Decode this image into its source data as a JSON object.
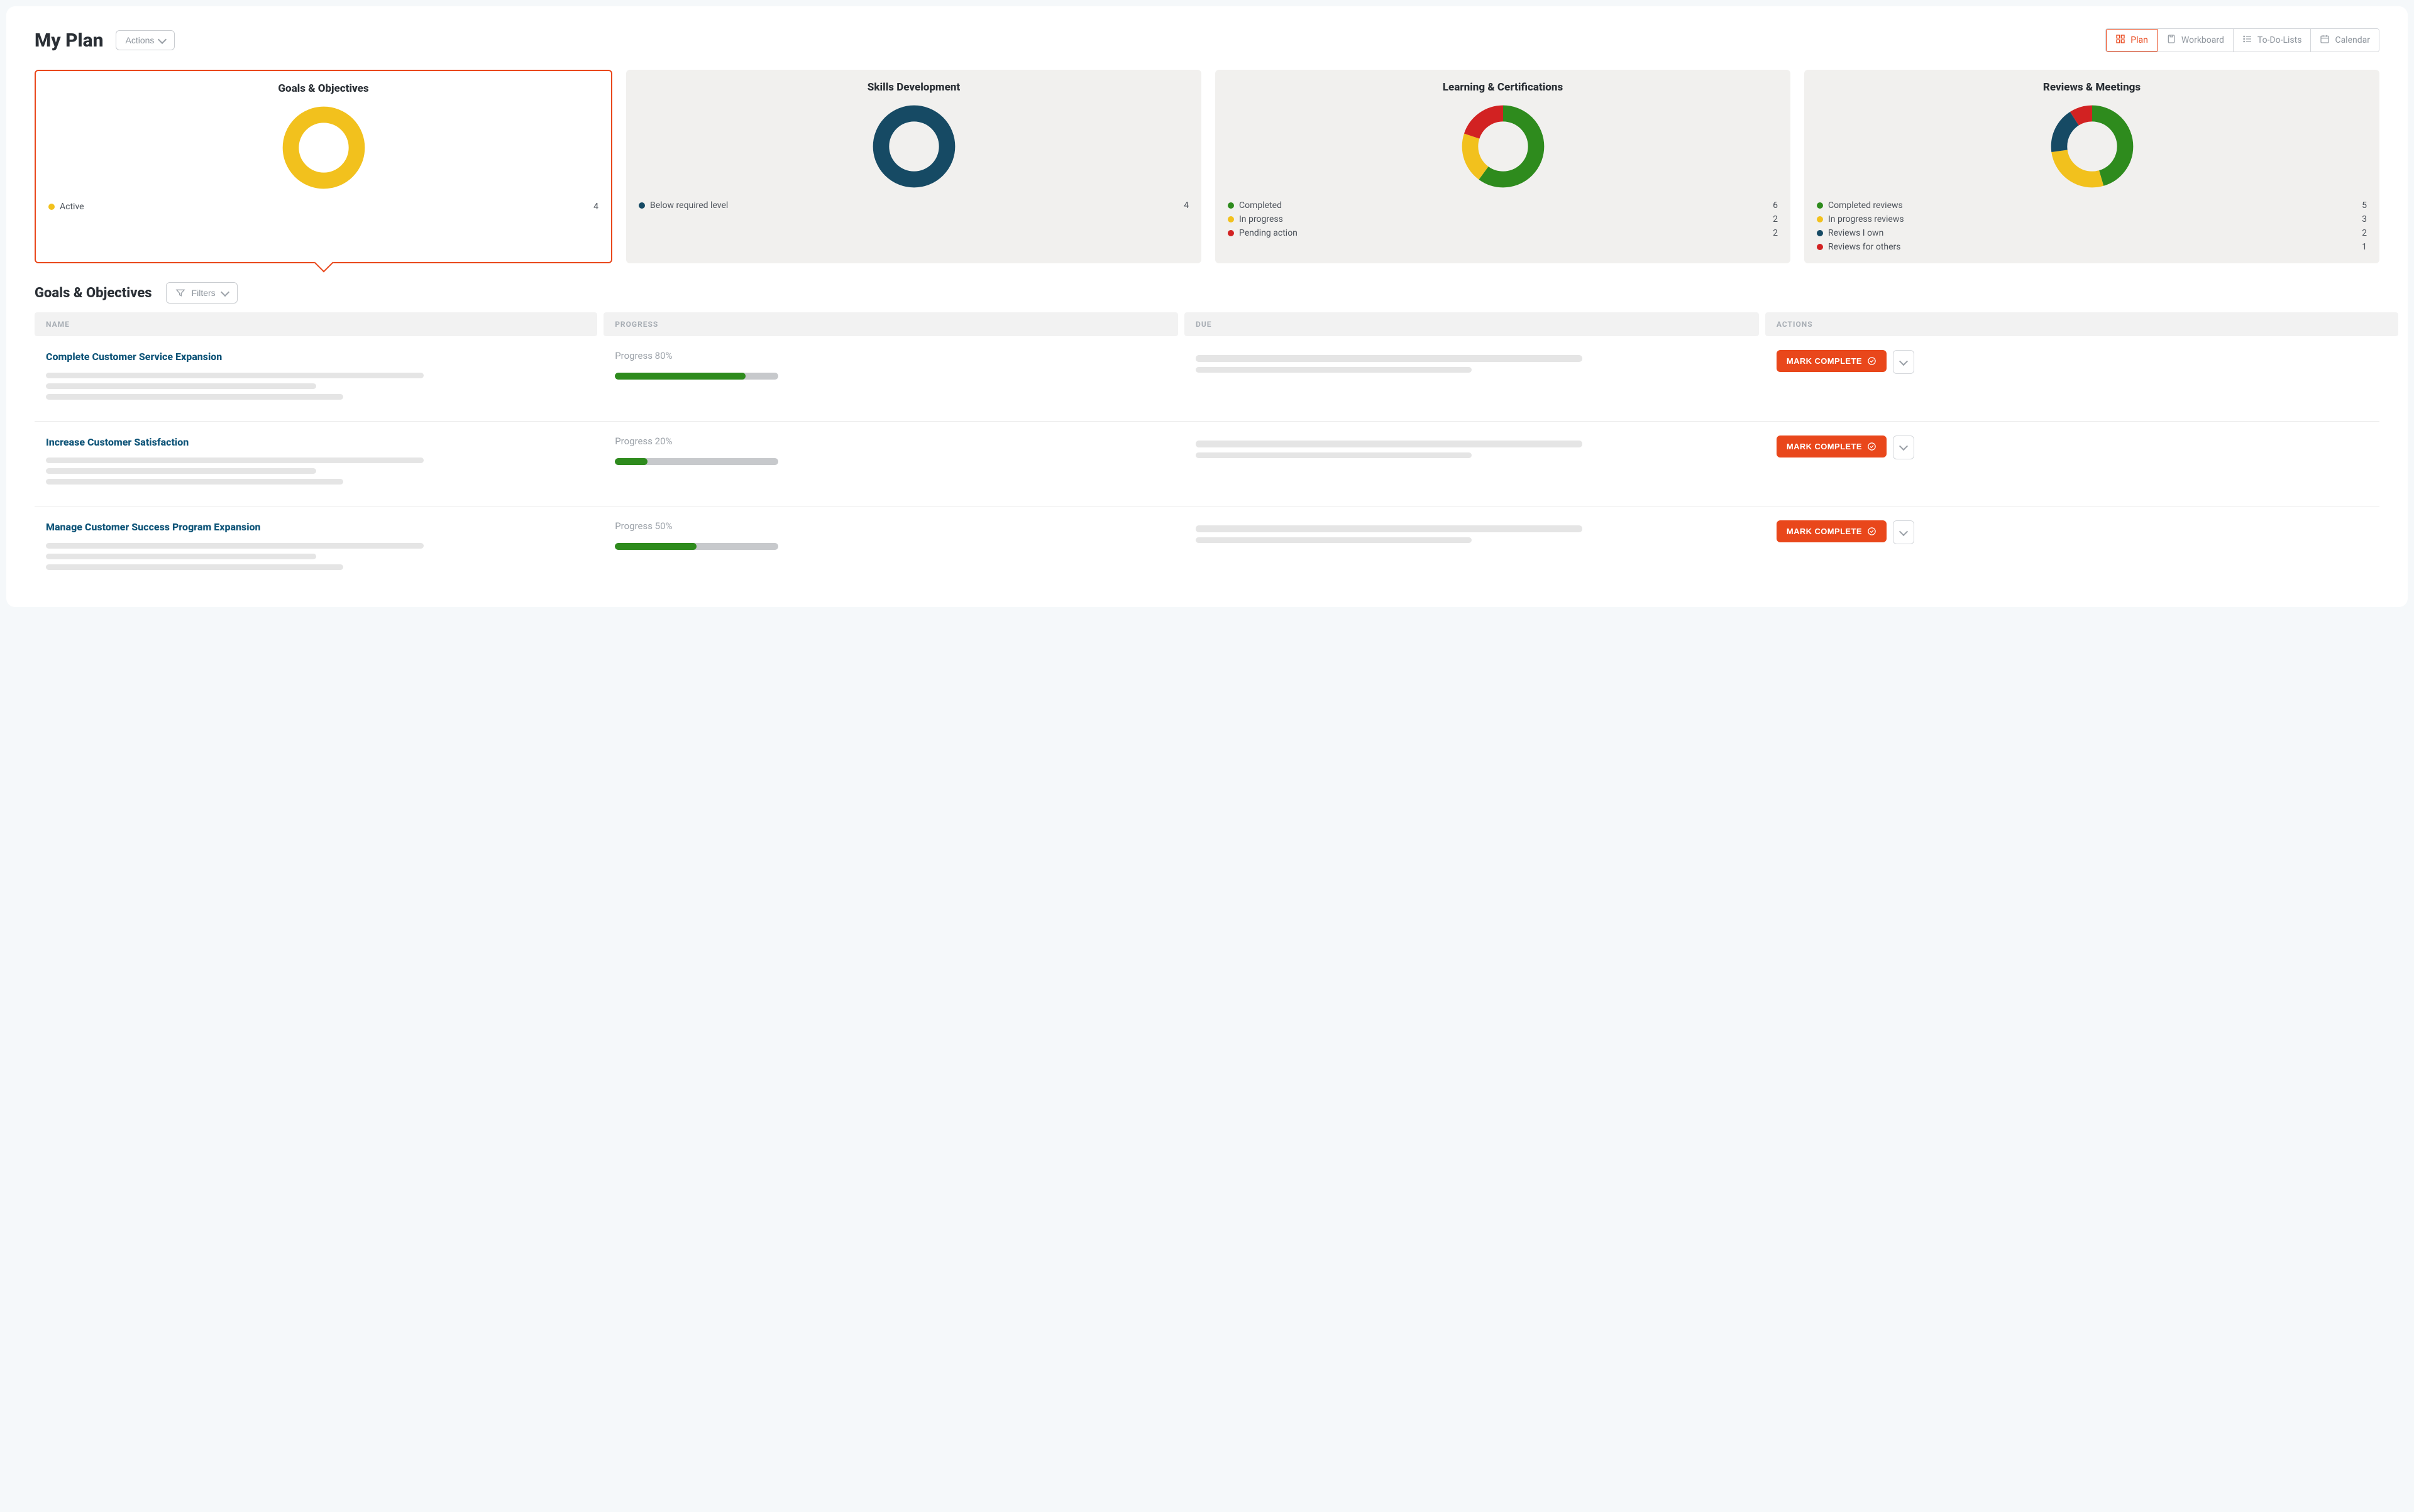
{
  "page_title": "My Plan",
  "actions_button": "Actions",
  "view_tabs": [
    {
      "id": "plan",
      "label": "Plan",
      "active": true
    },
    {
      "id": "workboard",
      "label": "Workboard",
      "active": false
    },
    {
      "id": "todo",
      "label": "To-Do-Lists",
      "active": false
    },
    {
      "id": "calendar",
      "label": "Calendar",
      "active": false
    }
  ],
  "colors": {
    "yellow": "#f2c11d",
    "navy": "#164a64",
    "green": "#2e8b1d",
    "red": "#d22222",
    "accent": "#e9471b"
  },
  "cards": [
    {
      "id": "goals",
      "title": "Goals & Objectives",
      "active": true,
      "legend": [
        {
          "label": "Active",
          "value": 4,
          "color": "#f2c11d"
        }
      ],
      "segments": [
        {
          "color": "#f2c11d",
          "fraction": 1.0
        }
      ]
    },
    {
      "id": "skills",
      "title": "Skills Development",
      "active": false,
      "legend": [
        {
          "label": "Below required level",
          "value": 4,
          "color": "#164a64"
        }
      ],
      "segments": [
        {
          "color": "#164a64",
          "fraction": 1.0
        }
      ]
    },
    {
      "id": "learning",
      "title": "Learning & Certifications",
      "active": false,
      "legend": [
        {
          "label": "Completed",
          "value": 6,
          "color": "#2e8b1d"
        },
        {
          "label": "In progress",
          "value": 2,
          "color": "#f2c11d"
        },
        {
          "label": "Pending action",
          "value": 2,
          "color": "#d22222"
        }
      ],
      "segments": [
        {
          "color": "#2e8b1d",
          "fraction": 0.6
        },
        {
          "color": "#f2c11d",
          "fraction": 0.2
        },
        {
          "color": "#d22222",
          "fraction": 0.2
        }
      ]
    },
    {
      "id": "reviews",
      "title": "Reviews & Meetings",
      "active": false,
      "legend": [
        {
          "label": "Completed reviews",
          "value": 5,
          "color": "#2e8b1d"
        },
        {
          "label": "In progress reviews",
          "value": 3,
          "color": "#f2c11d"
        },
        {
          "label": "Reviews I own",
          "value": 2,
          "color": "#164a64"
        },
        {
          "label": "Reviews for others",
          "value": 1,
          "color": "#d22222"
        }
      ],
      "segments": [
        {
          "color": "#2e8b1d",
          "fraction": 0.4545
        },
        {
          "color": "#f2c11d",
          "fraction": 0.2727
        },
        {
          "color": "#164a64",
          "fraction": 0.1818
        },
        {
          "color": "#d22222",
          "fraction": 0.0909
        }
      ]
    }
  ],
  "section": {
    "title": "Goals & Objectives",
    "filters_label": "Filters",
    "columns": {
      "name": "NAME",
      "progress": "PROGRESS",
      "due": "DUE",
      "actions": "ACTIONS"
    },
    "mark_complete_label": "MARK COMPLETE",
    "rows": [
      {
        "name": "Complete Customer Service Expansion",
        "progress_label": "Progress 80%",
        "progress_pct": 80
      },
      {
        "name": "Increase Customer Satisfaction",
        "progress_label": "Progress 20%",
        "progress_pct": 20
      },
      {
        "name": "Manage Customer Success Program Expansion",
        "progress_label": "Progress 50%",
        "progress_pct": 50
      }
    ]
  },
  "chart_data": [
    {
      "type": "pie",
      "title": "Goals & Objectives",
      "categories": [
        "Active"
      ],
      "values": [
        4
      ]
    },
    {
      "type": "pie",
      "title": "Skills Development",
      "categories": [
        "Below required level"
      ],
      "values": [
        4
      ]
    },
    {
      "type": "pie",
      "title": "Learning & Certifications",
      "categories": [
        "Completed",
        "In progress",
        "Pending action"
      ],
      "values": [
        6,
        2,
        2
      ]
    },
    {
      "type": "pie",
      "title": "Reviews & Meetings",
      "categories": [
        "Completed reviews",
        "In progress reviews",
        "Reviews I own",
        "Reviews for others"
      ],
      "values": [
        5,
        3,
        2,
        1
      ]
    }
  ]
}
